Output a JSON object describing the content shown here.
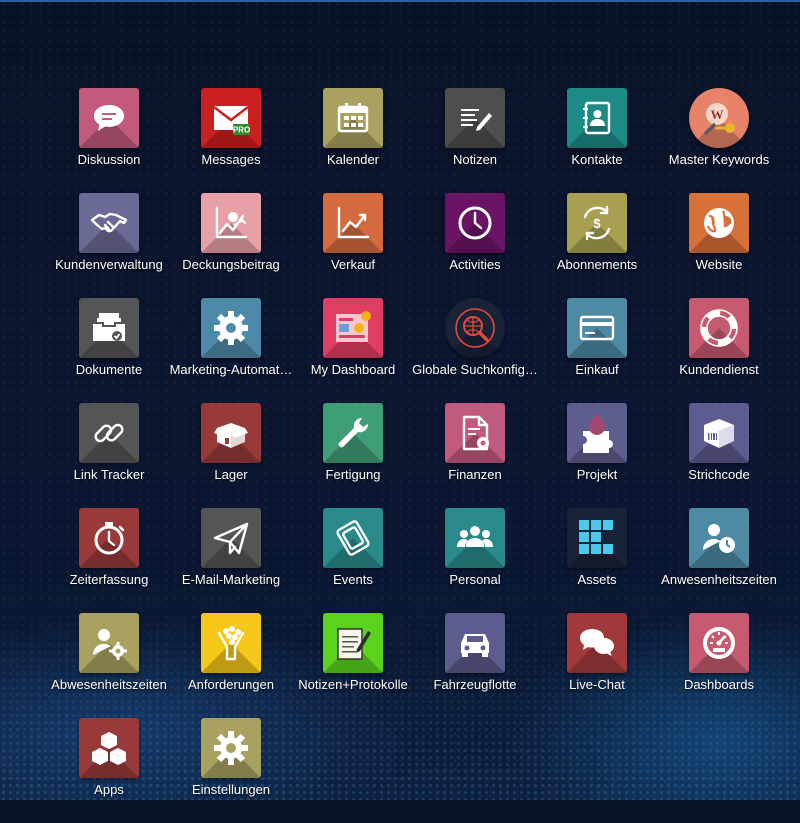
{
  "apps": [
    {
      "label": "Diskussion",
      "icon": "chat-bubble-icon",
      "color": "#c15a7c"
    },
    {
      "label": "Messages",
      "icon": "envelope-pro-icon",
      "color": "#cc1f1f"
    },
    {
      "label": "Kalender",
      "icon": "calendar-icon",
      "color": "#a9a160"
    },
    {
      "label": "Notizen",
      "icon": "note-pencil-icon",
      "color": "#4e4e4e"
    },
    {
      "label": "Kontakte",
      "icon": "address-book-icon",
      "color": "#1e8a86"
    },
    {
      "label": "Master Keywords",
      "icon": "keyword-key-icon",
      "color": "#e8836a"
    },
    {
      "label": "Kundenverwaltung",
      "icon": "handshake-icon",
      "color": "#6a6a96"
    },
    {
      "label": "Deckungsbeitrag",
      "icon": "chart-person-icon",
      "color": "#e8a0a8"
    },
    {
      "label": "Verkauf",
      "icon": "trend-chart-icon",
      "color": "#d46b3e"
    },
    {
      "label": "Activities",
      "icon": "clock-icon",
      "color": "#6b1465"
    },
    {
      "label": "Abonnements",
      "icon": "recurring-dollar-icon",
      "color": "#a8a050"
    },
    {
      "label": "Website",
      "icon": "globe-icon",
      "color": "#d8703a"
    },
    {
      "label": "Dokumente",
      "icon": "inbox-tray-icon",
      "color": "#555555"
    },
    {
      "label": "Marketing-Automat…",
      "icon": "gear-icon",
      "color": "#4d8aa8"
    },
    {
      "label": "My Dashboard",
      "icon": "dashboard-screen-icon",
      "color": "#e03d63"
    },
    {
      "label": "Globale Suchkonfig…",
      "icon": "globe-search-icon",
      "color": "#1a2238"
    },
    {
      "label": "Einkauf",
      "icon": "credit-card-icon",
      "color": "#4e8aa4"
    },
    {
      "label": "Kundendienst",
      "icon": "lifebuoy-icon",
      "color": "#c55a70"
    },
    {
      "label": "Link Tracker",
      "icon": "link-icon",
      "color": "#555555"
    },
    {
      "label": "Lager",
      "icon": "open-box-icon",
      "color": "#983a3a"
    },
    {
      "label": "Fertigung",
      "icon": "wrench-icon",
      "color": "#3f9e76"
    },
    {
      "label": "Finanzen",
      "icon": "document-gear-icon",
      "color": "#c05a7e"
    },
    {
      "label": "Projekt",
      "icon": "puzzle-drop-icon",
      "color": "#5e5e8e"
    },
    {
      "label": "Strichcode",
      "icon": "barcode-box-icon",
      "color": "#5c5c8e"
    },
    {
      "label": "Zeiterfassung",
      "icon": "stopwatch-icon",
      "color": "#983a3a"
    },
    {
      "label": "E-Mail-Marketing",
      "icon": "paper-plane-icon",
      "color": "#555555"
    },
    {
      "label": "Events",
      "icon": "ticket-icon",
      "color": "#2a8a8a"
    },
    {
      "label": "Personal",
      "icon": "people-icon",
      "color": "#2a8a8a"
    },
    {
      "label": "Assets",
      "icon": "grid-blocks-icon",
      "color": "#1a2238"
    },
    {
      "label": "Anwesenheitszeiten",
      "icon": "user-clock-icon",
      "color": "#4e8aa4"
    },
    {
      "label": "Abwesenheitszeiten",
      "icon": "user-gear-icon",
      "color": "#a9a160"
    },
    {
      "label": "Anforderungen",
      "icon": "hand-dots-icon",
      "color": "#f5c71a"
    },
    {
      "label": "Notizen+Protokolle",
      "icon": "notepad-pen-icon",
      "color": "#5ad21e"
    },
    {
      "label": "Fahrzeugflotte",
      "icon": "car-icon",
      "color": "#5c5c8e"
    },
    {
      "label": "Live-Chat",
      "icon": "chat-bubbles-icon",
      "color": "#a03a3a"
    },
    {
      "label": "Dashboards",
      "icon": "speedometer-icon",
      "color": "#c55a70"
    },
    {
      "label": "Apps",
      "icon": "cubes-icon",
      "color": "#983a3a"
    },
    {
      "label": "Einstellungen",
      "icon": "settings-gear-icon",
      "color": "#a9a160"
    }
  ]
}
